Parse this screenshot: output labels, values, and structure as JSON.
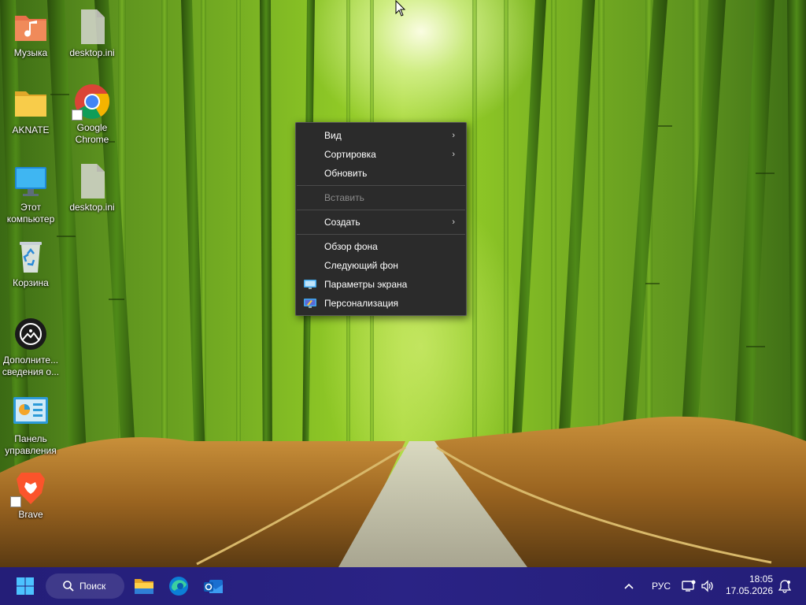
{
  "desktop": {
    "icons": [
      {
        "label": "Музыка",
        "icon": "music-folder-icon"
      },
      {
        "label": "desktop.ini",
        "icon": "ini-file-icon"
      },
      {
        "label": "AKNATE",
        "icon": "folder-icon"
      },
      {
        "label": "Google Chrome",
        "icon": "chrome-icon"
      },
      {
        "label": "Этот компьютер",
        "icon": "this-pc-icon"
      },
      {
        "label": "desktop.ini",
        "icon": "ini-file-icon"
      },
      {
        "label": "Корзина",
        "icon": "recycle-bin-icon"
      },
      {
        "label": "Дополнительные сведения о...",
        "label_display": "Дополните...\nсведения о...",
        "icon": "info-icon"
      },
      {
        "label": "Панель управления",
        "icon": "control-panel-icon"
      },
      {
        "label": "Brave",
        "icon": "brave-icon"
      }
    ]
  },
  "context_menu": {
    "items": [
      {
        "label": "Вид",
        "submenu": true,
        "enabled": true
      },
      {
        "label": "Сортировка",
        "submenu": true,
        "enabled": true
      },
      {
        "label": "Обновить",
        "submenu": false,
        "enabled": true
      },
      {
        "label": "Вставить",
        "submenu": false,
        "enabled": false
      },
      {
        "label": "Создать",
        "submenu": true,
        "enabled": true
      },
      {
        "label": "Обзор фона",
        "submenu": false,
        "enabled": true
      },
      {
        "label": "Следующий фон",
        "submenu": false,
        "enabled": true
      },
      {
        "label": "Параметры экрана",
        "submenu": false,
        "enabled": true,
        "icon": "display-settings-icon"
      },
      {
        "label": "Персонализация",
        "submenu": false,
        "enabled": true,
        "icon": "personalization-icon"
      }
    ],
    "submenu_glyph": "›"
  },
  "taskbar": {
    "search_label": "Поиск",
    "apps": [
      "start-icon",
      "file-explorer-icon",
      "edge-icon",
      "outlook-icon"
    ],
    "tray": {
      "chevron": "^",
      "language": "РУС",
      "time": "18:05",
      "date": "17.05.2026"
    },
    "colors": {
      "background": "#26217a"
    }
  },
  "colors": {
    "menu_bg": "#2b2b2b",
    "menu_disabled": "#8a8a8a"
  }
}
